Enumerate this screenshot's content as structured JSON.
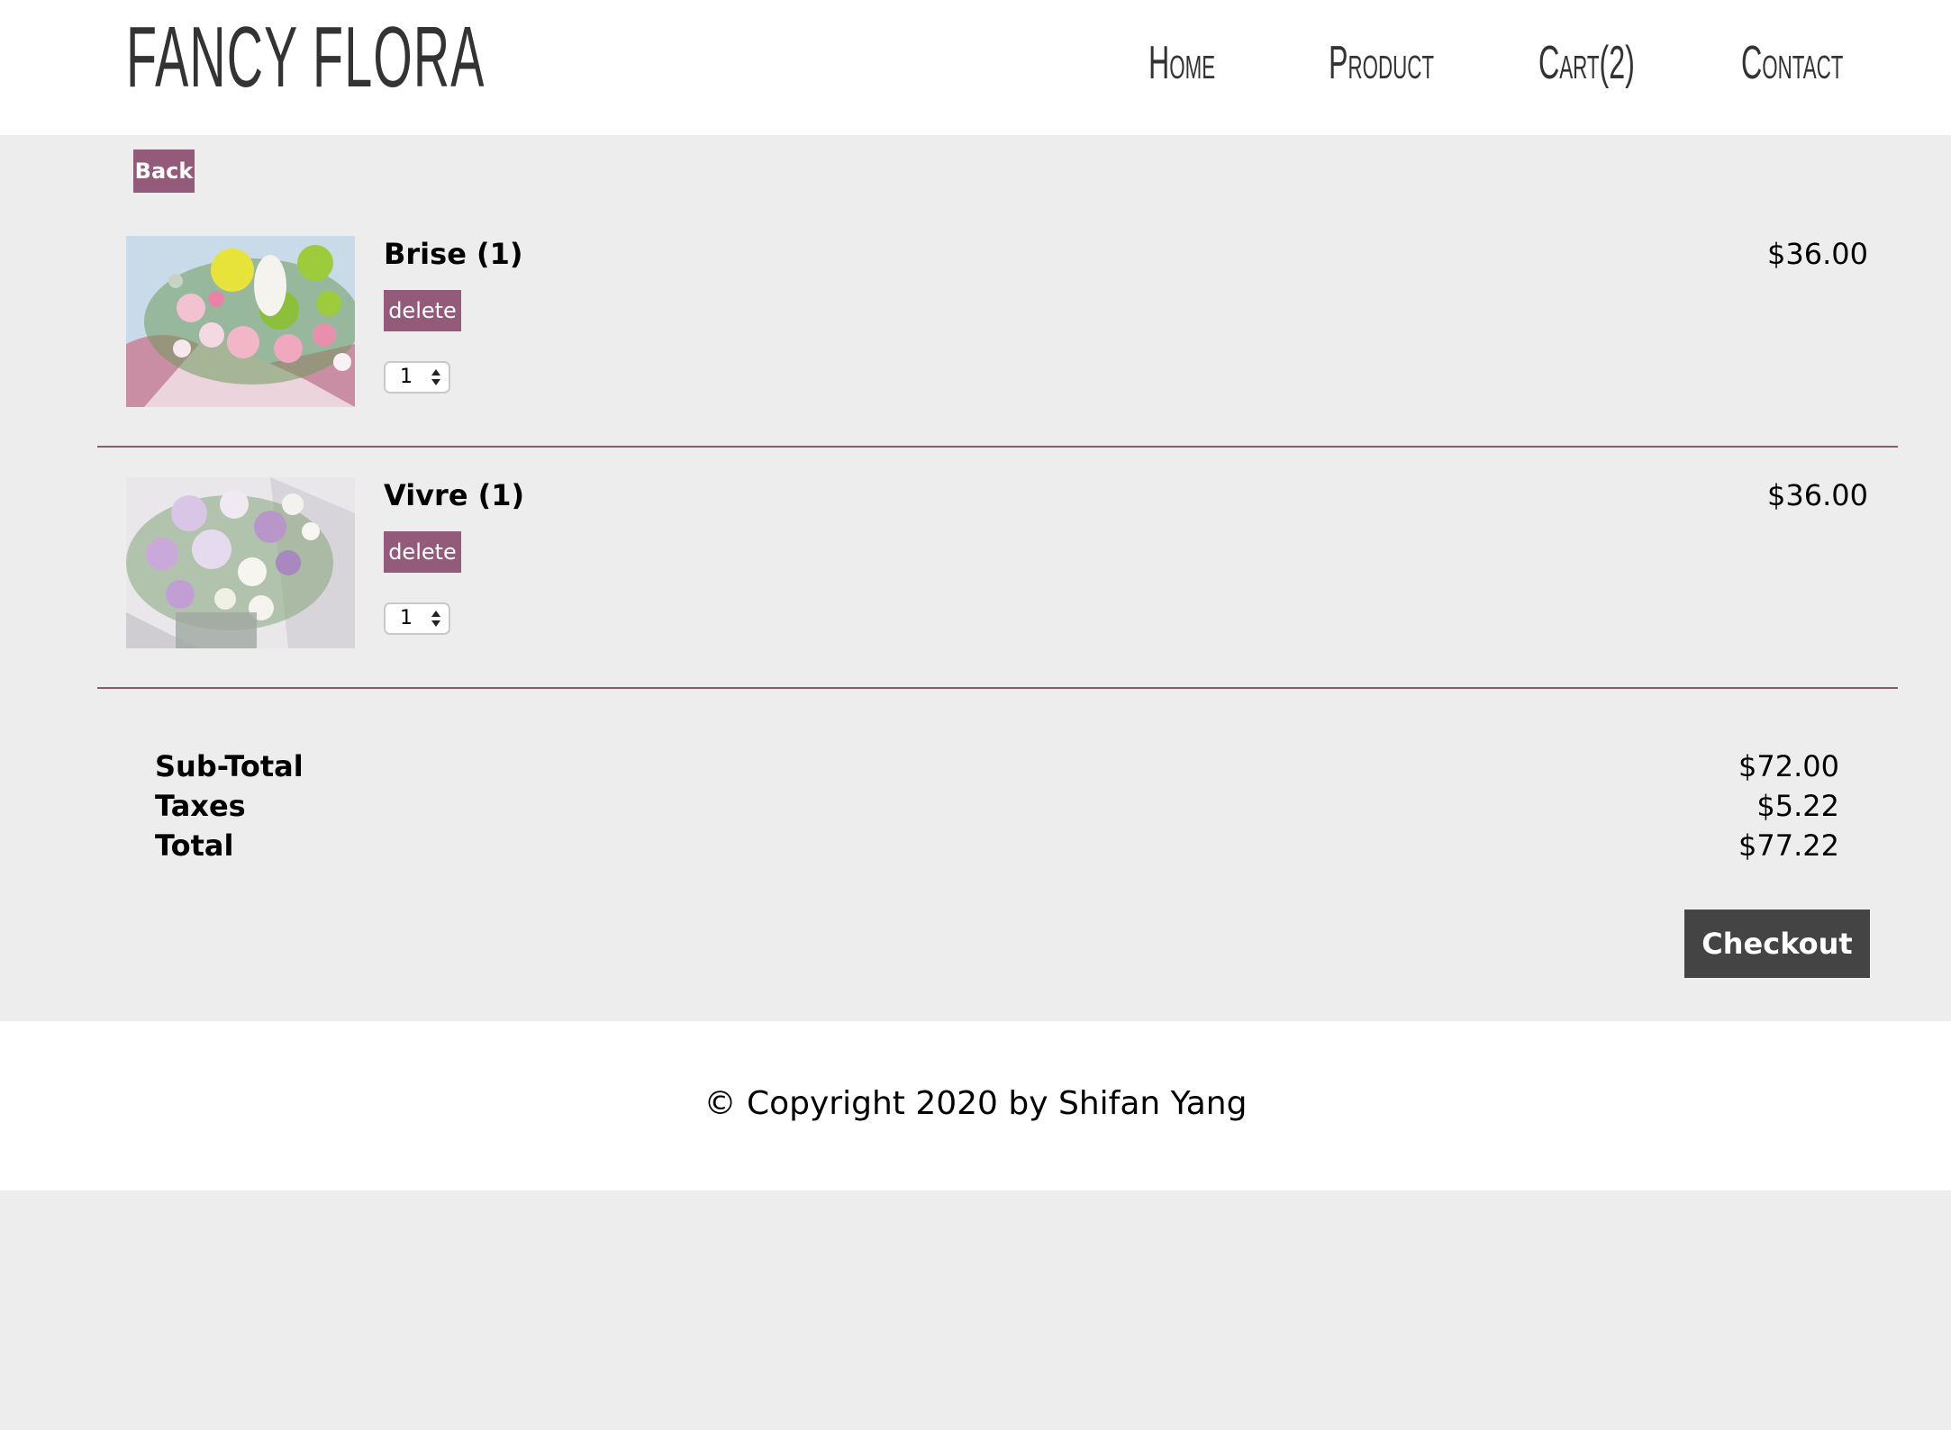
{
  "header": {
    "logo": "FANCY FLORA",
    "nav": [
      {
        "label": "Home"
      },
      {
        "label": "Product"
      },
      {
        "label": "Cart(2)"
      },
      {
        "label": "Contact"
      }
    ]
  },
  "main": {
    "back_label": "Back",
    "cart_items": [
      {
        "name": "Brise (1)",
        "delete_label": "delete",
        "quantity": "1",
        "price": "$36.00"
      },
      {
        "name": "Vivre (1)",
        "delete_label": "delete",
        "quantity": "1",
        "price": "$36.00"
      }
    ],
    "summary": {
      "subtotal_label": "Sub-Total",
      "subtotal_value": "$72.00",
      "taxes_label": "Taxes",
      "taxes_value": "$5.22",
      "total_label": "Total",
      "total_value": "$77.22"
    },
    "checkout_label": "Checkout"
  },
  "footer": {
    "copyright": "© Copyright 2020 by Shifan Yang"
  },
  "colors": {
    "accent": "#935a79",
    "divider": "#8a5a70",
    "checkout_bg": "#444444",
    "page_bg": "#ededed"
  }
}
